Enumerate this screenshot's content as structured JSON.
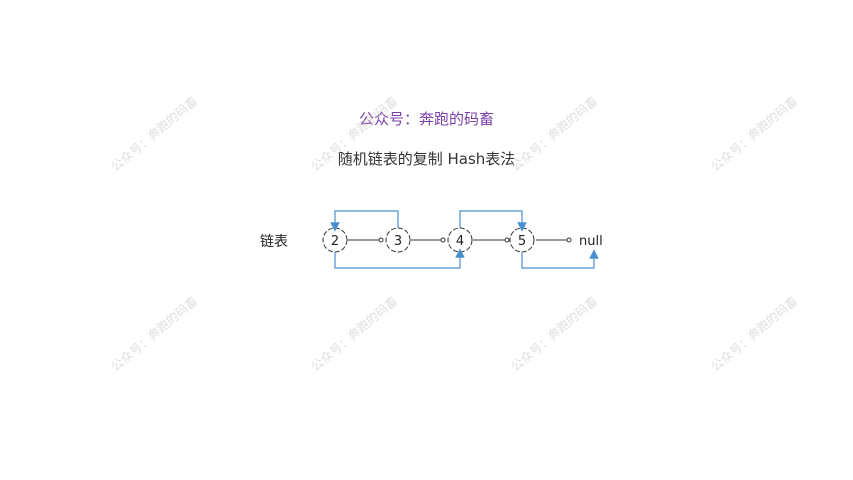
{
  "header": {
    "account": "公众号：奔跑的码畜"
  },
  "subtitle": "随机链表的复制 Hash表法",
  "watermark": "公众号：奔跑的码畜",
  "diagram": {
    "list_label": "链表",
    "nodes": [
      "2",
      "3",
      "4",
      "5"
    ],
    "terminal": "null",
    "colors": {
      "random_pointer": "#4a90d0",
      "node_stroke": "#333333"
    }
  }
}
